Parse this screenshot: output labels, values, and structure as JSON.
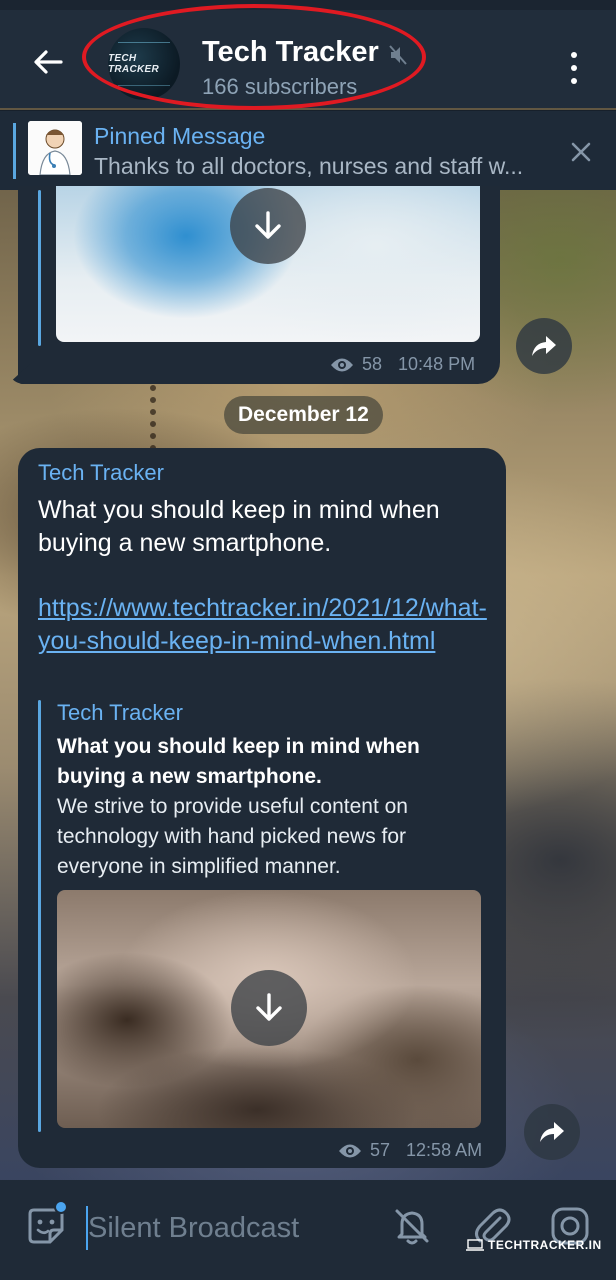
{
  "header": {
    "back_icon": "arrow-left-icon",
    "title": "Tech Tracker",
    "subtitle": "166 subscribers",
    "avatar_text": "TECH TRACKER",
    "muted_icon": "speaker-muted-icon",
    "menu_icon": "more-vertical-icon"
  },
  "pinned": {
    "label": "Pinned Message",
    "text": "Thanks to all doctors, nurses and staff w...",
    "close_icon": "close-icon"
  },
  "messages": [
    {
      "views": "58",
      "time": "10:48 PM"
    },
    {
      "date_divider": "December 12",
      "sender": "Tech Tracker",
      "text": "What you should keep in mind when buying a new smartphone.",
      "link": "https://www.techtracker.in/2021/12/what-you-should-keep-in-mind-when.html",
      "preview": {
        "site": "Tech Tracker",
        "title": "What you should keep in mind when buying a new smartphone.",
        "description": "We strive to provide useful content on technology with hand picked news for everyone in simplified manner."
      },
      "views": "57",
      "time": "12:58 AM"
    }
  ],
  "composer": {
    "placeholder": "Silent Broadcast",
    "icons": [
      "sticker-icon",
      "bell-off-icon",
      "paperclip-icon",
      "camera-icon"
    ]
  },
  "watermark": "TECHTRACKER.IN",
  "colors": {
    "header_bg": "#212d3b",
    "bubble_bg": "#1f2a37",
    "accent": "#6ab2f2",
    "highlight": "#e01a22"
  }
}
